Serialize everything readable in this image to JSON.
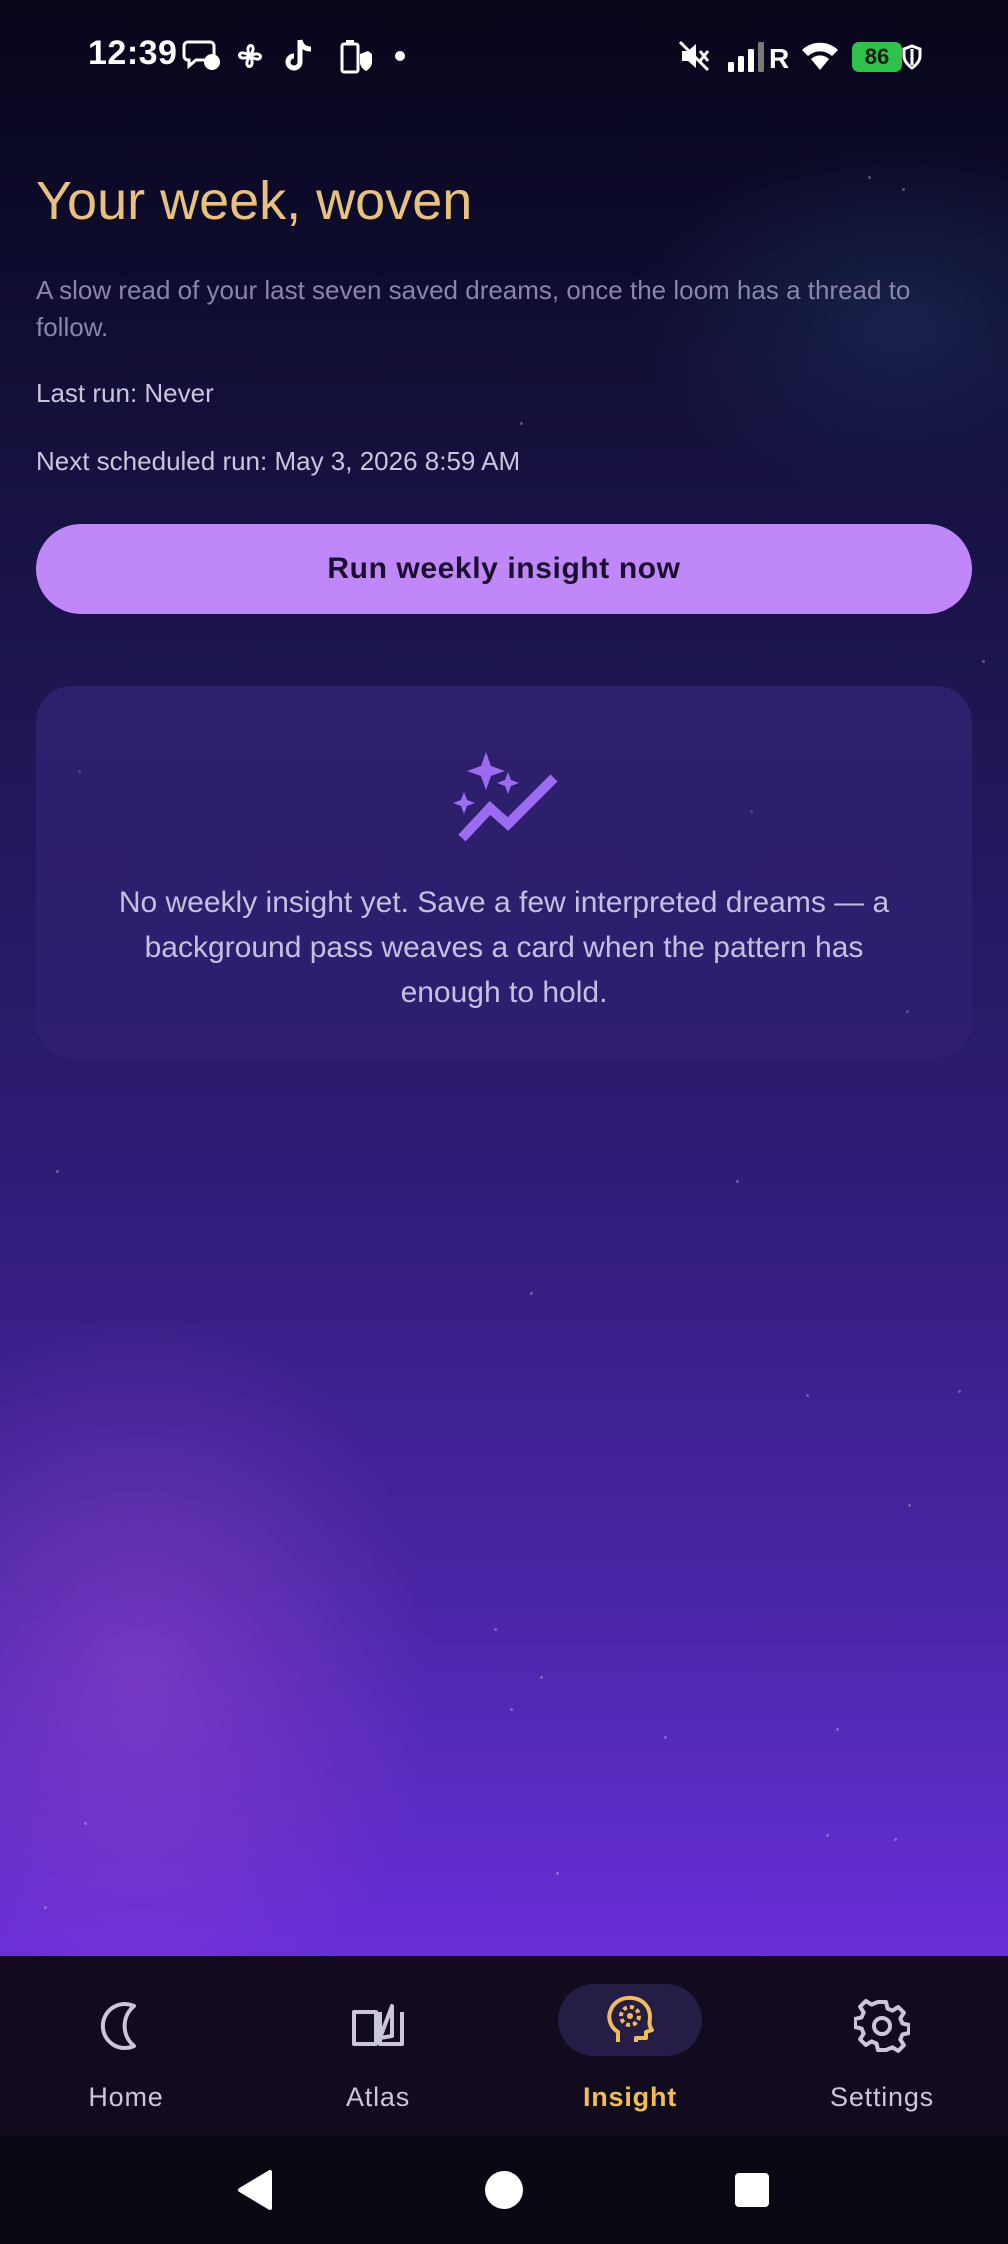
{
  "status_bar": {
    "time": "12:39",
    "battery": "86",
    "icons": [
      "chat-bubble-icon",
      "pinwheel-icon",
      "tiktok-icon",
      "battery-saver-icon",
      "dot-icon",
      "mute-icon",
      "signal-icon",
      "roaming-r-icon",
      "wifi-icon",
      "shield-icon"
    ]
  },
  "main": {
    "title": "Your week, woven",
    "subtitle": "A slow read of your last seven saved dreams, once the loom has a thread to follow.",
    "last_run": "Last run: Never",
    "next_run": "Next scheduled run: May 3, 2026 8:59 AM",
    "run_button": "Run weekly insight now",
    "empty_icon": "sparkle-trend-icon",
    "empty_message": "No weekly insight yet. Save a few interpreted dreams — a background pass weaves a card when the pattern has enough to hold."
  },
  "bottom_nav": {
    "items": [
      {
        "label": "Home",
        "icon": "moon-icon",
        "active": false
      },
      {
        "label": "Atlas",
        "icon": "book-icon",
        "active": false
      },
      {
        "label": "Insight",
        "icon": "head-insight-icon",
        "active": true
      },
      {
        "label": "Settings",
        "icon": "gear-icon",
        "active": false
      }
    ]
  },
  "system_nav": {
    "icons": [
      "back-icon",
      "home-circle-icon",
      "recents-square-icon"
    ]
  },
  "colors": {
    "title_gold": "#e8c27c",
    "button_purple": "#bf87f7",
    "active_nav": "#f0be55",
    "accent_violet": "#9b6cf2"
  }
}
